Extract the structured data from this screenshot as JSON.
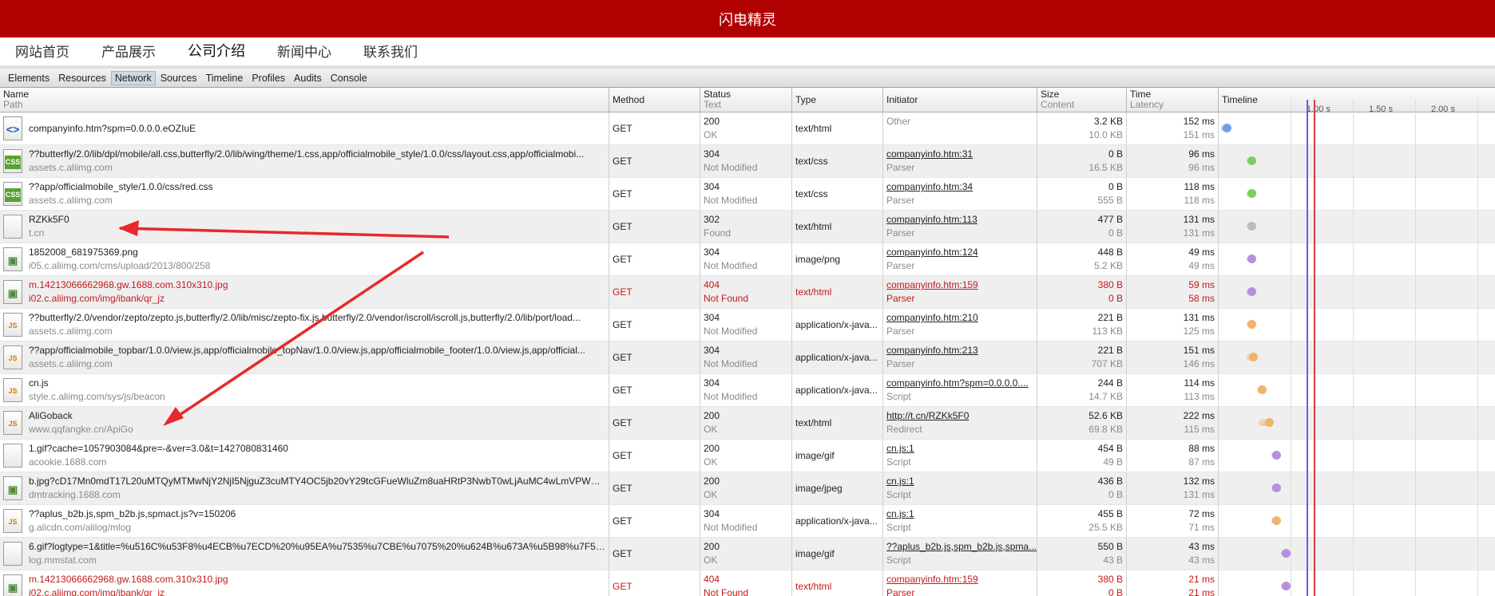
{
  "site": {
    "title": "闪电精灵",
    "nav": [
      "网站首页",
      "产品展示",
      "公司介绍",
      "新闻中心",
      "联系我们"
    ],
    "active_nav": 2
  },
  "devtools": {
    "tabs": [
      "Elements",
      "Resources",
      "Network",
      "Sources",
      "Timeline",
      "Profiles",
      "Audits",
      "Console"
    ],
    "active_tab": "Network"
  },
  "columns": {
    "name": "Name",
    "name_sub": "Path",
    "method": "Method",
    "status": "Status",
    "status_sub": "Text",
    "type": "Type",
    "initiator": "Initiator",
    "size": "Size",
    "size_sub": "Content",
    "time": "Time",
    "time_sub": "Latency",
    "timeline": "Timeline"
  },
  "timeline_scale": [
    "1.00 s",
    "1.50 s",
    "2.00 s"
  ],
  "requests": [
    {
      "name": "companyinfo.htm?spm=0.0.0.0.eOZIuE",
      "path": "",
      "icon": "html",
      "method": "GET",
      "status": "200",
      "status_text": "OK",
      "type": "text/html",
      "initiator": "Other",
      "initiator_sub": "",
      "initiator_link": false,
      "size": "3.2 KB",
      "content": "10.0 KB",
      "time": "152 ms",
      "latency": "151 ms",
      "tl_start": 0.01,
      "tl_len": 0.03,
      "color": "#6fa0e8",
      "error": false
    },
    {
      "name": "??butterfly/2.0/lib/dpl/mobile/all.css,butterfly/2.0/lib/wing/theme/1.css,app/officialmobile_style/1.0.0/css/layout.css,app/officialmobi...",
      "path": "assets.c.aliimg.com",
      "icon": "css",
      "method": "GET",
      "status": "304",
      "status_text": "Not Modified",
      "type": "text/css",
      "initiator": "companyinfo.htm:31",
      "initiator_sub": "Parser",
      "initiator_link": true,
      "size": "0 B",
      "content": "16.5 KB",
      "time": "96 ms",
      "latency": "96 ms",
      "tl_start": 0.1,
      "tl_len": 0.025,
      "color": "#7fcf5f",
      "error": false
    },
    {
      "name": "??app/officialmobile_style/1.0.0/css/red.css",
      "path": "assets.c.aliimg.com",
      "icon": "css",
      "method": "GET",
      "status": "304",
      "status_text": "Not Modified",
      "type": "text/css",
      "initiator": "companyinfo.htm:34",
      "initiator_sub": "Parser",
      "initiator_link": true,
      "size": "0 B",
      "content": "555 B",
      "time": "118 ms",
      "latency": "118 ms",
      "tl_start": 0.1,
      "tl_len": 0.028,
      "color": "#7fcf5f",
      "error": false
    },
    {
      "name": "RZKk5F0",
      "path": "t.cn",
      "icon": "blank",
      "method": "GET",
      "status": "302",
      "status_text": "Found",
      "type": "text/html",
      "initiator": "companyinfo.htm:113",
      "initiator_sub": "Parser",
      "initiator_link": true,
      "size": "477 B",
      "content": "0 B",
      "time": "131 ms",
      "latency": "131 ms",
      "tl_start": 0.1,
      "tl_len": 0.03,
      "color": "#bbbbbb",
      "error": false
    },
    {
      "name": "1852008_681975369.png",
      "path": "i05.c.aliimg.com/cms/upload/2013/800/258",
      "icon": "img",
      "method": "GET",
      "status": "304",
      "status_text": "Not Modified",
      "type": "image/png",
      "initiator": "companyinfo.htm:124",
      "initiator_sub": "Parser",
      "initiator_link": true,
      "size": "448 B",
      "content": "5.2 KB",
      "time": "49 ms",
      "latency": "49 ms",
      "tl_start": 0.1,
      "tl_len": 0.012,
      "color": "#b88fe0",
      "error": false
    },
    {
      "name": "m.14213066662968.gw.1688.com.310x310.jpg",
      "path": "i02.c.aliimg.com/img/ibank/qr_jz",
      "icon": "img",
      "method": "GET",
      "status": "404",
      "status_text": "Not Found",
      "type": "text/html",
      "initiator": "companyinfo.htm:159",
      "initiator_sub": "Parser",
      "initiator_link": true,
      "size": "380 B",
      "content": "0 B",
      "time": "59 ms",
      "latency": "58 ms",
      "tl_start": 0.1,
      "tl_len": 0.014,
      "color": "#b88fe0",
      "error": true
    },
    {
      "name": "??butterfly/2.0/vendor/zepto/zepto.js,butterfly/2.0/lib/misc/zepto-fix.js,butterfly/2.0/vendor/iscroll/iscroll.js,butterfly/2.0/lib/port/load...",
      "path": "assets.c.aliimg.com",
      "icon": "js",
      "method": "GET",
      "status": "304",
      "status_text": "Not Modified",
      "type": "application/x-java...",
      "initiator": "companyinfo.htm:210",
      "initiator_sub": "Parser",
      "initiator_link": true,
      "size": "221 B",
      "content": "113 KB",
      "time": "131 ms",
      "latency": "125 ms",
      "tl_start": 0.1,
      "tl_len": 0.03,
      "color": "#f0b46e",
      "error": false
    },
    {
      "name": "??app/officialmobile_topbar/1.0.0/view.js,app/officialmobile_topNav/1.0.0/view.js,app/officialmobile_footer/1.0.0/view.js,app/official...",
      "path": "assets.c.aliimg.com",
      "icon": "js",
      "method": "GET",
      "status": "304",
      "status_text": "Not Modified",
      "type": "application/x-java...",
      "initiator": "companyinfo.htm:213",
      "initiator_sub": "Parser",
      "initiator_link": true,
      "size": "221 B",
      "content": "707 KB",
      "time": "151 ms",
      "latency": "146 ms",
      "tl_start": 0.1,
      "tl_len": 0.035,
      "color": "#f0b46e",
      "error": false
    },
    {
      "name": "cn.js",
      "path": "style.c.aliimg.com/sys/js/beacon",
      "icon": "js",
      "method": "GET",
      "status": "304",
      "status_text": "Not Modified",
      "type": "application/x-java...",
      "initiator": "companyinfo.htm?spm=0.0.0.0....",
      "initiator_sub": "Script",
      "initiator_link": true,
      "size": "244 B",
      "content": "14.7 KB",
      "time": "114 ms",
      "latency": "113 ms",
      "tl_start": 0.14,
      "tl_len": 0.027,
      "color": "#f0b46e",
      "error": false
    },
    {
      "name": "AliGoback",
      "path": "www.qqfangke.cn/ApiGo",
      "icon": "js",
      "method": "GET",
      "status": "200",
      "status_text": "OK",
      "type": "text/html",
      "initiator": "http://t.cn/RZKk5F0",
      "initiator_sub": "Redirect",
      "initiator_link": true,
      "size": "52.6 KB",
      "content": "69.8 KB",
      "time": "222 ms",
      "latency": "115 ms",
      "tl_start": 0.145,
      "tl_len": 0.05,
      "color": "#f0b46e",
      "error": false
    },
    {
      "name": "1.gif?cache=1057903084&pre=-&ver=3.0&t=1427080831460",
      "path": "acookie.1688.com",
      "icon": "blank",
      "method": "GET",
      "status": "200",
      "status_text": "OK",
      "type": "image/gif",
      "initiator": "cn.js:1",
      "initiator_sub": "Script",
      "initiator_link": true,
      "size": "454 B",
      "content": "49 B",
      "time": "88 ms",
      "latency": "87 ms",
      "tl_start": 0.19,
      "tl_len": 0.02,
      "color": "#b88fe0",
      "error": false
    },
    {
      "name": "b.jpg?cD17Mn0mdT17L20uMTQyMTMwNjY2NjI5NjguZ3cuMTY4OC5jb20vY29tcGFueWluZm8uaHRtP3NwbT0wLjAuMC4wLmVPWmx...",
      "path": "dmtracking.1688.com",
      "icon": "img",
      "method": "GET",
      "status": "200",
      "status_text": "OK",
      "type": "image/jpeg",
      "initiator": "cn.js:1",
      "initiator_sub": "Script",
      "initiator_link": true,
      "size": "436 B",
      "content": "0 B",
      "time": "132 ms",
      "latency": "131 ms",
      "tl_start": 0.19,
      "tl_len": 0.03,
      "color": "#b88fe0",
      "error": false
    },
    {
      "name": "??aplus_b2b.js,spm_b2b.js,spmact.js?v=150206",
      "path": "g.alicdn.com/alilog/mlog",
      "icon": "js",
      "method": "GET",
      "status": "304",
      "status_text": "Not Modified",
      "type": "application/x-java...",
      "initiator": "cn.js:1",
      "initiator_sub": "Script",
      "initiator_link": true,
      "size": "455 B",
      "content": "25.5 KB",
      "time": "72 ms",
      "latency": "71 ms",
      "tl_start": 0.19,
      "tl_len": 0.017,
      "color": "#f0b46e",
      "error": false
    },
    {
      "name": "6.gif?logtype=1&title=%u516C%u53F8%u4ECB%u7ECD%20%u95EA%u7535%u7CBE%u7075%20%u624B%u673A%u5B98%u7F51&pre...",
      "path": "log.mmstat.com",
      "icon": "blank",
      "method": "GET",
      "status": "200",
      "status_text": "OK",
      "type": "image/gif",
      "initiator": "??aplus_b2b.js,spm_b2b.js,spma...",
      "initiator_sub": "Script",
      "initiator_link": true,
      "size": "550 B",
      "content": "43 B",
      "time": "43 ms",
      "latency": "43 ms",
      "tl_start": 0.225,
      "tl_len": 0.01,
      "color": "#b88fe0",
      "error": false
    },
    {
      "name": "m.14213066662968.gw.1688.com.310x310.jpg",
      "path": "i02.c.aliimg.com/img/ibank/qr_jz",
      "icon": "img",
      "method": "GET",
      "status": "404",
      "status_text": "Not Found",
      "type": "text/html",
      "initiator": "companyinfo.htm:159",
      "initiator_sub": "Parser",
      "initiator_link": true,
      "size": "380 B",
      "content": "0 B",
      "time": "21 ms",
      "latency": "21 ms",
      "tl_start": 0.225,
      "tl_len": 0.008,
      "color": "#b88fe0",
      "error": true
    }
  ],
  "colors": {
    "header_red": "#b10000",
    "error_red": "#c41a1a",
    "blue_line": "#5d5df0",
    "red_line": "#d24040"
  }
}
